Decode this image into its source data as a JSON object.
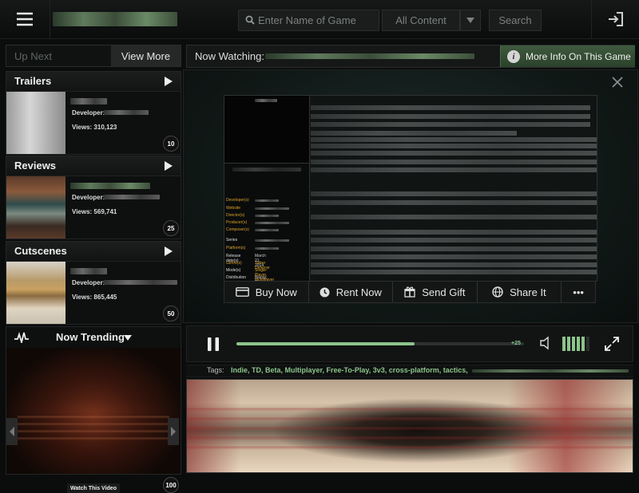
{
  "topbar": {
    "search_placeholder": "Enter Name of Game",
    "content_filter": "All Content",
    "search_button": "Search",
    "menu_icon": "hamburger-menu-icon",
    "signin_icon": "sign-in-icon"
  },
  "upnext": {
    "tab_label": "Up Next",
    "view_more": "View More"
  },
  "categories": [
    {
      "title": "Trailers",
      "developer_label": "Developer:",
      "views": "Views: 310,123",
      "badge": "10"
    },
    {
      "title": "Reviews",
      "developer_label": "Developer:",
      "views": "Views: 569,741",
      "badge": "25"
    },
    {
      "title": "Cutscenes",
      "developer_label": "Developer:",
      "views": "Views: 865,445",
      "badge": "50"
    }
  ],
  "trending": {
    "label": "Now Trending",
    "watch_button": "Watch This Video",
    "count": "100"
  },
  "now_watching": {
    "label": "Now Watching:",
    "more_info": "More Info On This Game"
  },
  "info_panel": {
    "rows": [
      {
        "key": "Developer(s)",
        "value": ""
      },
      {
        "key": "Website",
        "value": ""
      },
      {
        "key": "Director(s)",
        "value": ""
      },
      {
        "key": "Producer(s)",
        "value": ""
      },
      {
        "key": "Composer(s)",
        "value": ""
      },
      {
        "key": "Series",
        "value": ""
      },
      {
        "key": "Platform(s)",
        "value": ""
      },
      {
        "key": "Release date(s)",
        "value": "March 21, 2014"
      },
      {
        "key": "Genre(s)",
        "value": "Tower Defense"
      },
      {
        "key": "Mode(s)",
        "value": "Single-Player, Multiplayer"
      },
      {
        "key": "Distribution",
        "value": "Bluray, Disc, download"
      }
    ]
  },
  "actions": [
    {
      "label": "Buy Now",
      "icon": "credit-card-icon"
    },
    {
      "label": "Rent Now",
      "icon": "clock-icon"
    },
    {
      "label": "Send Gift",
      "icon": "gift-icon"
    },
    {
      "label": "Share It",
      "icon": "globe-icon"
    },
    {
      "label": "•••",
      "icon": "more-icon"
    }
  ],
  "player": {
    "progress": 0.62,
    "skip_label": "+25",
    "volume_level": 5,
    "volume_total": 6
  },
  "tags": {
    "label": "Tags:",
    "values": "Indie, TD, Beta, Multiplayer, Free-To-Play, 3v3, cross-platform, tactics,"
  },
  "colors": {
    "accent_green": "#8cc48a",
    "info_key_orange": "#d9a32a"
  }
}
